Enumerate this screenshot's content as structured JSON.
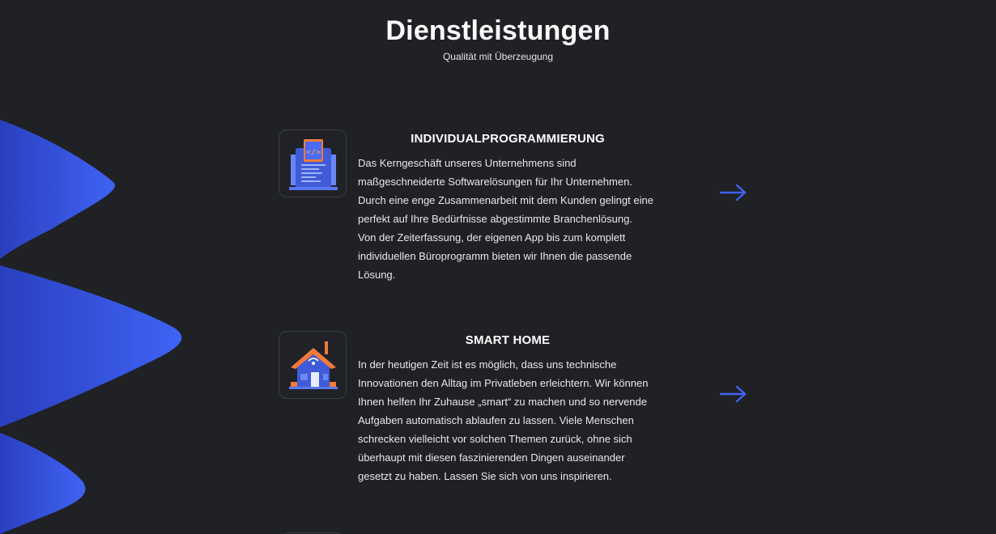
{
  "header": {
    "title": "Dienstleistungen",
    "subtitle": "Qualität mit Überzeugung"
  },
  "services": [
    {
      "title": "INDIVIDUALPROGRAMMIERUNG",
      "icon": "code-laptop-icon",
      "text": "Das Kerngeschäft unseres Unternehmens sind\nmaßgeschneiderte Softwarelösungen für Ihr Unternehmen.\nDurch eine enge Zusammenarbeit mit dem Kunden gelingt eine\nperfekt auf Ihre Bedürfnisse abgestimmte Branchenlösung.\nVon der Zeiterfassung, der eigenen App bis zum komplett\nindividuellen Büroprogramm bieten wir Ihnen die passende\nLösung."
    },
    {
      "title": "SMART HOME",
      "icon": "smart-house-icon",
      "text": "In der heutigen Zeit ist es möglich, dass uns technische\nInnovationen den Alltag im Privatleben erleichtern. Wir können\nIhnen helfen Ihr Zuhause „smart“ zu machen und so nervende\nAufgaben automatisch ablaufen zu lassen. Viele Menschen\nschrecken vielleicht vor solchen Themen zurück, ohne sich\nüberhaupt mit diesen faszinierenden Dingen auseinander\ngesetzt zu haben. Lassen Sie sich von uns inspirieren."
    }
  ],
  "colors": {
    "background": "#1f2125",
    "accent": "#3f63f4",
    "icon_orange": "#f27a3a"
  }
}
